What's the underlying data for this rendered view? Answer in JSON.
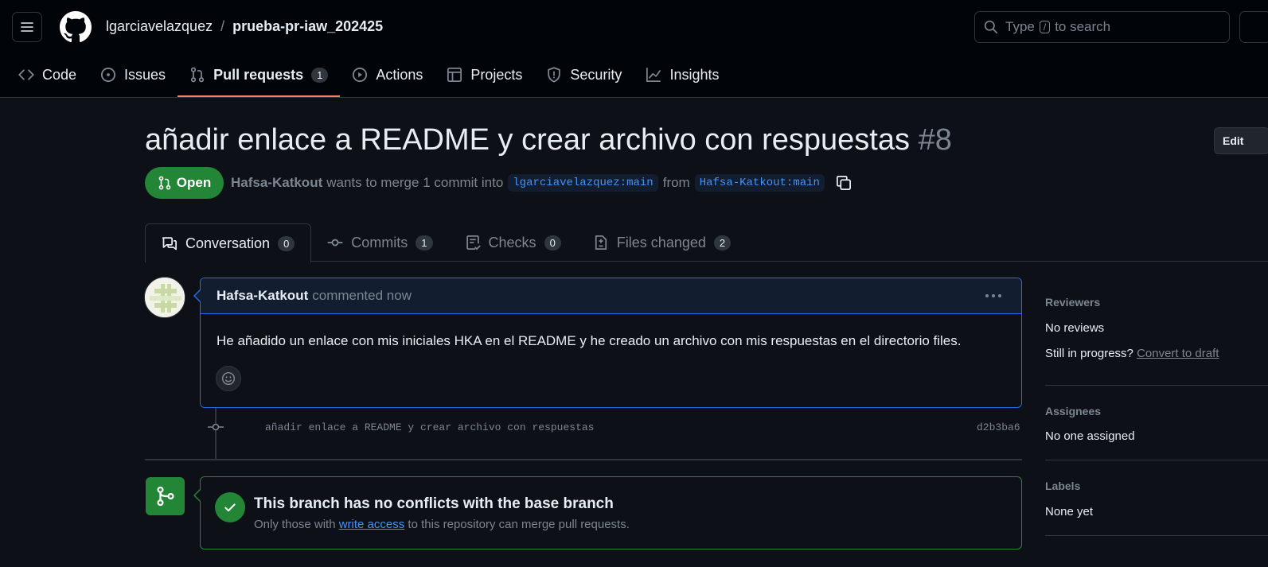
{
  "header": {
    "owner": "lgarciavelazquez",
    "separator": "/",
    "repo": "prueba-pr-iaw_202425",
    "search_type": "Type",
    "search_key": "/",
    "search_rest": "to search"
  },
  "repo_tabs": [
    {
      "label": "Code",
      "icon": "code-icon"
    },
    {
      "label": "Issues",
      "icon": "issue-icon"
    },
    {
      "label": "Pull requests",
      "icon": "pull-request-icon",
      "count": "1",
      "active": true
    },
    {
      "label": "Actions",
      "icon": "play-icon"
    },
    {
      "label": "Projects",
      "icon": "table-icon"
    },
    {
      "label": "Security",
      "icon": "shield-icon"
    },
    {
      "label": "Insights",
      "icon": "graph-icon"
    }
  ],
  "pr": {
    "title": "añadir enlace a README y crear archivo con respuestas",
    "number": "#8",
    "edit_label": "Edit",
    "state": "Open",
    "author": "Hafsa-Katkout",
    "merge_text": "wants to merge 1 commit into",
    "base_branch": "lgarciavelazquez:main",
    "from_text": "from",
    "head_branch": "Hafsa-Katkout:main"
  },
  "pr_tabs": [
    {
      "label": "Conversation",
      "count": "0",
      "icon": "comment-discussion-icon",
      "active": true
    },
    {
      "label": "Commits",
      "count": "1",
      "icon": "commit-icon"
    },
    {
      "label": "Checks",
      "count": "0",
      "icon": "checklist-icon"
    },
    {
      "label": "Files changed",
      "count": "2",
      "icon": "file-diff-icon"
    }
  ],
  "comment": {
    "author": "Hafsa-Katkout",
    "when": "commented now",
    "body": "He añadido un enlace con mis iniciales HKA en el README y he creado un archivo con mis respuestas en el directorio files."
  },
  "commit": {
    "message": "añadir enlace a README y crear archivo con respuestas",
    "sha": "d2b3ba6"
  },
  "merge": {
    "title": "This branch has no conflicts with the base branch",
    "sub_before": "Only those with",
    "sub_link": "write access",
    "sub_after": "to this repository can merge pull requests."
  },
  "sidebar": {
    "reviewers_h": "Reviewers",
    "reviewers_v": "No reviews",
    "progress_q": "Still in progress?",
    "progress_link": "Convert to draft",
    "assignees_h": "Assignees",
    "assignees_v": "No one assigned",
    "labels_h": "Labels",
    "labels_v": "None yet"
  },
  "colors": {
    "accent_open": "#238636",
    "link": "#4493f8",
    "tab_underline": "#f78166"
  }
}
